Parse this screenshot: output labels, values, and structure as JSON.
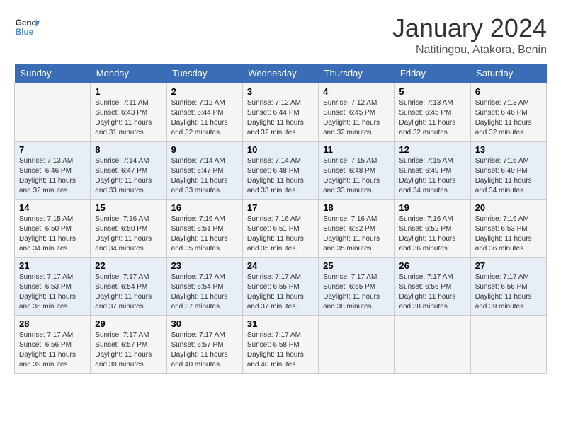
{
  "header": {
    "logo_general": "General",
    "logo_blue": "Blue",
    "title": "January 2024",
    "subtitle": "Natitingou, Atakora, Benin"
  },
  "weekdays": [
    "Sunday",
    "Monday",
    "Tuesday",
    "Wednesday",
    "Thursday",
    "Friday",
    "Saturday"
  ],
  "weeks": [
    [
      {
        "day": "",
        "info": ""
      },
      {
        "day": "1",
        "info": "Sunrise: 7:11 AM\nSunset: 6:43 PM\nDaylight: 11 hours and 31 minutes."
      },
      {
        "day": "2",
        "info": "Sunrise: 7:12 AM\nSunset: 6:44 PM\nDaylight: 11 hours and 32 minutes."
      },
      {
        "day": "3",
        "info": "Sunrise: 7:12 AM\nSunset: 6:44 PM\nDaylight: 11 hours and 32 minutes."
      },
      {
        "day": "4",
        "info": "Sunrise: 7:12 AM\nSunset: 6:45 PM\nDaylight: 11 hours and 32 minutes."
      },
      {
        "day": "5",
        "info": "Sunrise: 7:13 AM\nSunset: 6:45 PM\nDaylight: 11 hours and 32 minutes."
      },
      {
        "day": "6",
        "info": "Sunrise: 7:13 AM\nSunset: 6:46 PM\nDaylight: 11 hours and 32 minutes."
      }
    ],
    [
      {
        "day": "7",
        "info": "Sunrise: 7:13 AM\nSunset: 6:46 PM\nDaylight: 11 hours and 32 minutes."
      },
      {
        "day": "8",
        "info": "Sunrise: 7:14 AM\nSunset: 6:47 PM\nDaylight: 11 hours and 33 minutes."
      },
      {
        "day": "9",
        "info": "Sunrise: 7:14 AM\nSunset: 6:47 PM\nDaylight: 11 hours and 33 minutes."
      },
      {
        "day": "10",
        "info": "Sunrise: 7:14 AM\nSunset: 6:48 PM\nDaylight: 11 hours and 33 minutes."
      },
      {
        "day": "11",
        "info": "Sunrise: 7:15 AM\nSunset: 6:48 PM\nDaylight: 11 hours and 33 minutes."
      },
      {
        "day": "12",
        "info": "Sunrise: 7:15 AM\nSunset: 6:49 PM\nDaylight: 11 hours and 34 minutes."
      },
      {
        "day": "13",
        "info": "Sunrise: 7:15 AM\nSunset: 6:49 PM\nDaylight: 11 hours and 34 minutes."
      }
    ],
    [
      {
        "day": "14",
        "info": "Sunrise: 7:15 AM\nSunset: 6:50 PM\nDaylight: 11 hours and 34 minutes."
      },
      {
        "day": "15",
        "info": "Sunrise: 7:16 AM\nSunset: 6:50 PM\nDaylight: 11 hours and 34 minutes."
      },
      {
        "day": "16",
        "info": "Sunrise: 7:16 AM\nSunset: 6:51 PM\nDaylight: 11 hours and 35 minutes."
      },
      {
        "day": "17",
        "info": "Sunrise: 7:16 AM\nSunset: 6:51 PM\nDaylight: 11 hours and 35 minutes."
      },
      {
        "day": "18",
        "info": "Sunrise: 7:16 AM\nSunset: 6:52 PM\nDaylight: 11 hours and 35 minutes."
      },
      {
        "day": "19",
        "info": "Sunrise: 7:16 AM\nSunset: 6:52 PM\nDaylight: 11 hours and 36 minutes."
      },
      {
        "day": "20",
        "info": "Sunrise: 7:16 AM\nSunset: 6:53 PM\nDaylight: 11 hours and 36 minutes."
      }
    ],
    [
      {
        "day": "21",
        "info": "Sunrise: 7:17 AM\nSunset: 6:53 PM\nDaylight: 11 hours and 36 minutes."
      },
      {
        "day": "22",
        "info": "Sunrise: 7:17 AM\nSunset: 6:54 PM\nDaylight: 11 hours and 37 minutes."
      },
      {
        "day": "23",
        "info": "Sunrise: 7:17 AM\nSunset: 6:54 PM\nDaylight: 11 hours and 37 minutes."
      },
      {
        "day": "24",
        "info": "Sunrise: 7:17 AM\nSunset: 6:55 PM\nDaylight: 11 hours and 37 minutes."
      },
      {
        "day": "25",
        "info": "Sunrise: 7:17 AM\nSunset: 6:55 PM\nDaylight: 11 hours and 38 minutes."
      },
      {
        "day": "26",
        "info": "Sunrise: 7:17 AM\nSunset: 6:56 PM\nDaylight: 11 hours and 38 minutes."
      },
      {
        "day": "27",
        "info": "Sunrise: 7:17 AM\nSunset: 6:56 PM\nDaylight: 11 hours and 39 minutes."
      }
    ],
    [
      {
        "day": "28",
        "info": "Sunrise: 7:17 AM\nSunset: 6:56 PM\nDaylight: 11 hours and 39 minutes."
      },
      {
        "day": "29",
        "info": "Sunrise: 7:17 AM\nSunset: 6:57 PM\nDaylight: 11 hours and 39 minutes."
      },
      {
        "day": "30",
        "info": "Sunrise: 7:17 AM\nSunset: 6:57 PM\nDaylight: 11 hours and 40 minutes."
      },
      {
        "day": "31",
        "info": "Sunrise: 7:17 AM\nSunset: 6:58 PM\nDaylight: 11 hours and 40 minutes."
      },
      {
        "day": "",
        "info": ""
      },
      {
        "day": "",
        "info": ""
      },
      {
        "day": "",
        "info": ""
      }
    ]
  ]
}
